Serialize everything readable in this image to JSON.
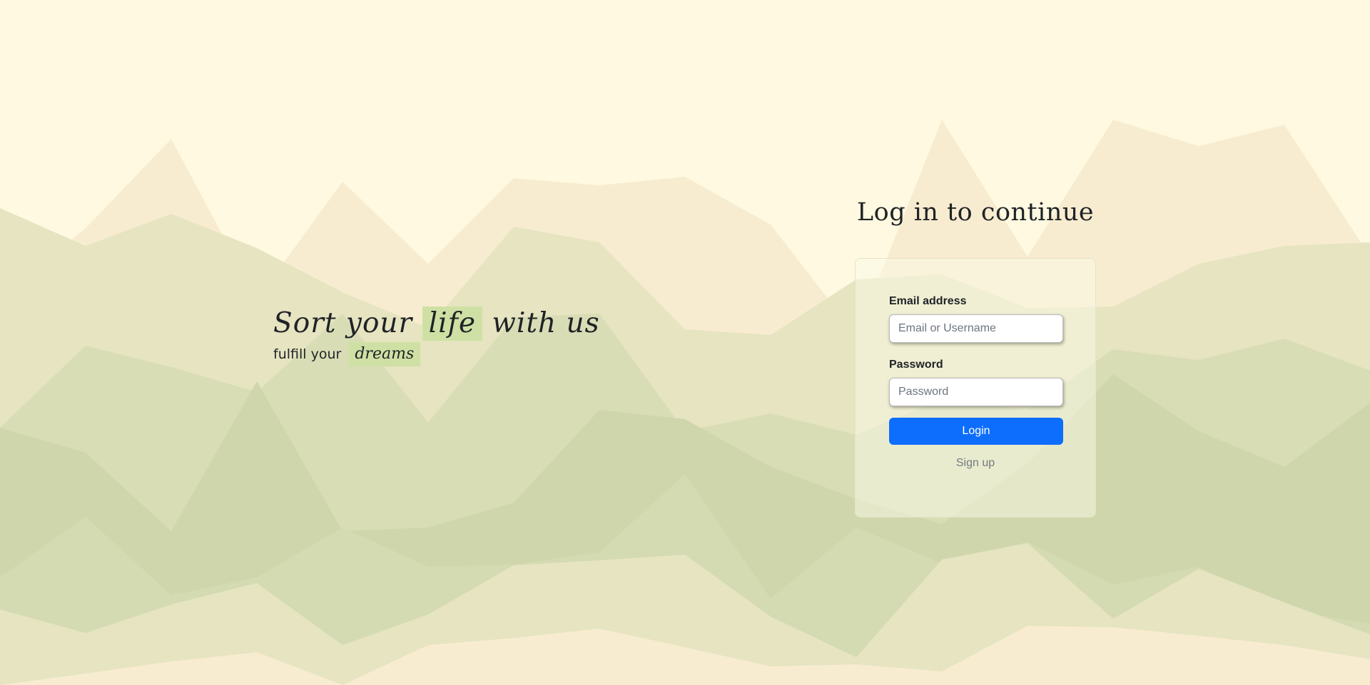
{
  "hero": {
    "title_before": "Sort your",
    "title_highlight": "life",
    "title_after": "with us",
    "subtitle_before": "fulfill your",
    "subtitle_highlight": "dreams"
  },
  "login": {
    "heading": "Log in to continue",
    "email_label": "Email address",
    "email_placeholder": "Email or Username",
    "email_value": "",
    "password_label": "Password",
    "password_placeholder": "Password",
    "password_value": "",
    "login_button": "Login",
    "signup_link": "Sign up"
  },
  "colors": {
    "background": "#fef9e0",
    "highlight": "#cfe0a4",
    "primary_button": "#0d6efd",
    "text": "#1f2326",
    "muted_link": "#747a80"
  }
}
